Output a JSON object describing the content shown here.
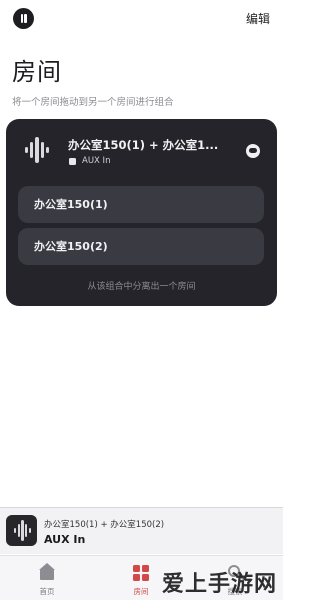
{
  "header": {
    "edit_label": "编辑"
  },
  "page": {
    "title": "房间",
    "subtitle": "将一个房间拖动到另一个房间进行组合"
  },
  "group": {
    "title": "办公室150(1) + 办公室1...",
    "source": "AUX In",
    "rooms": [
      "办公室150(1)",
      "办公室150(2)"
    ],
    "ungroup_note": "从该组合中分离出一个房间"
  },
  "now_playing": {
    "rooms": "办公室150(1) + 办公室150(2)",
    "source": "AUX In"
  },
  "tabs": [
    {
      "label": "首页",
      "icon": "home-icon",
      "active": false
    },
    {
      "label": "房间",
      "icon": "rooms-grid-icon",
      "active": true
    },
    {
      "label": "搜索",
      "icon": "search-icon",
      "active": false
    }
  ],
  "watermark": "爱上手游网",
  "colors": {
    "card_bg": "#24242a",
    "pill_bg": "#3a3a43",
    "accent": "#d14a4a"
  }
}
